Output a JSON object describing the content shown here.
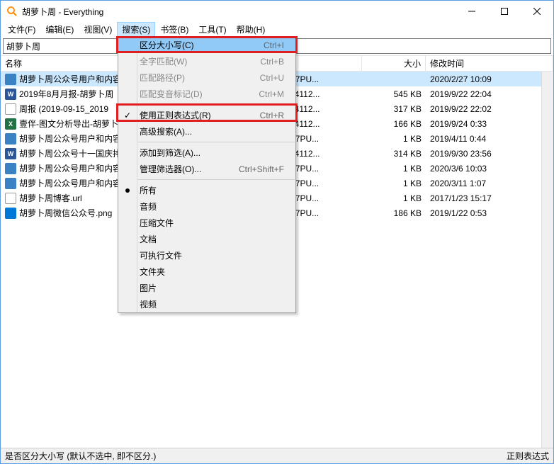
{
  "window": {
    "title": "胡萝卜周 - Everything"
  },
  "menubar": [
    {
      "label": "文件(F)"
    },
    {
      "label": "编辑(E)"
    },
    {
      "label": "视图(V)"
    },
    {
      "label": "搜索(S)",
      "active": true
    },
    {
      "label": "书签(B)"
    },
    {
      "label": "工具(T)"
    },
    {
      "label": "帮助(H)"
    }
  ],
  "search": {
    "value": "胡萝卜周"
  },
  "columns": {
    "name": "名称",
    "path": "",
    "size": "大小",
    "date": "修改时间"
  },
  "files": [
    {
      "name": "胡萝卜周公众号用户和内容",
      "icon": "km",
      "path": "KTOP-327PU...",
      "size": "",
      "date": "2020/2/27 10:09",
      "selected": true
    },
    {
      "name": "2019年8月月报-胡萝卜周",
      "icon": "docx",
      "path": "es\\hlz-134112...",
      "size": "545 KB",
      "date": "2019/9/22 22:04"
    },
    {
      "name": "周报 (2019-09-15_2019",
      "icon": "txt",
      "path": "es\\hlz-134112...",
      "size": "317 KB",
      "date": "2019/9/22 22:02"
    },
    {
      "name": "壹伴-图文分析导出-胡萝卜",
      "icon": "xlsx",
      "path": "es\\hlz-134112...",
      "size": "166 KB",
      "date": "2019/9/24 0:33"
    },
    {
      "name": "胡萝卜周公众号用户和内容",
      "icon": "km",
      "path": "KTOP-327PU...",
      "size": "1 KB",
      "date": "2019/4/11 0:44"
    },
    {
      "name": "胡萝卜周公众号十一国庆排",
      "icon": "docx",
      "path": "es\\hlz-134112...",
      "size": "314 KB",
      "date": "2019/9/30 23:56"
    },
    {
      "name": "胡萝卜周公众号用户和内容",
      "icon": "km",
      "path": "KTOP-327PU...",
      "size": "1 KB",
      "date": "2020/3/6 10:03"
    },
    {
      "name": "胡萝卜周公众号用户和内容",
      "icon": "km",
      "path": "KTOP-327PU...",
      "size": "1 KB",
      "date": "2020/3/11 1:07"
    },
    {
      "name": "胡萝卜周博客.url",
      "icon": "url",
      "path": "KTOP-327PU...",
      "size": "1 KB",
      "date": "2017/1/23 15:17"
    },
    {
      "name": "胡萝卜周微信公众号.png",
      "icon": "png",
      "path": "KTOP-327PU...",
      "size": "186 KB",
      "date": "2019/1/22 0:53"
    }
  ],
  "dropdown": [
    {
      "type": "item",
      "label": "区分大小写(C)",
      "shortcut": "Ctrl+I",
      "highlight": true
    },
    {
      "type": "item",
      "label": "全字匹配(W)",
      "shortcut": "Ctrl+B",
      "disabled": true
    },
    {
      "type": "item",
      "label": "匹配路径(P)",
      "shortcut": "Ctrl+U",
      "disabled": true
    },
    {
      "type": "item",
      "label": "匹配变音标记(D)",
      "shortcut": "Ctrl+M",
      "disabled": true
    },
    {
      "type": "sep"
    },
    {
      "type": "item",
      "label": "使用正则表达式(R)",
      "shortcut": "Ctrl+R",
      "checked": true
    },
    {
      "type": "item",
      "label": "高级搜索(A)..."
    },
    {
      "type": "sep"
    },
    {
      "type": "item",
      "label": "添加到筛选(A)..."
    },
    {
      "type": "item",
      "label": "管理筛选器(O)...",
      "shortcut": "Ctrl+Shift+F"
    },
    {
      "type": "sep"
    },
    {
      "type": "item",
      "label": "所有",
      "bullet": true
    },
    {
      "type": "item",
      "label": "音频"
    },
    {
      "type": "item",
      "label": "压缩文件"
    },
    {
      "type": "item",
      "label": "文档"
    },
    {
      "type": "item",
      "label": "可执行文件"
    },
    {
      "type": "item",
      "label": "文件夹"
    },
    {
      "type": "item",
      "label": "图片"
    },
    {
      "type": "item",
      "label": "视频"
    }
  ],
  "statusbar": {
    "left": "是否区分大小写 (默认不选中, 即不区分.)",
    "right": "正则表达式"
  }
}
